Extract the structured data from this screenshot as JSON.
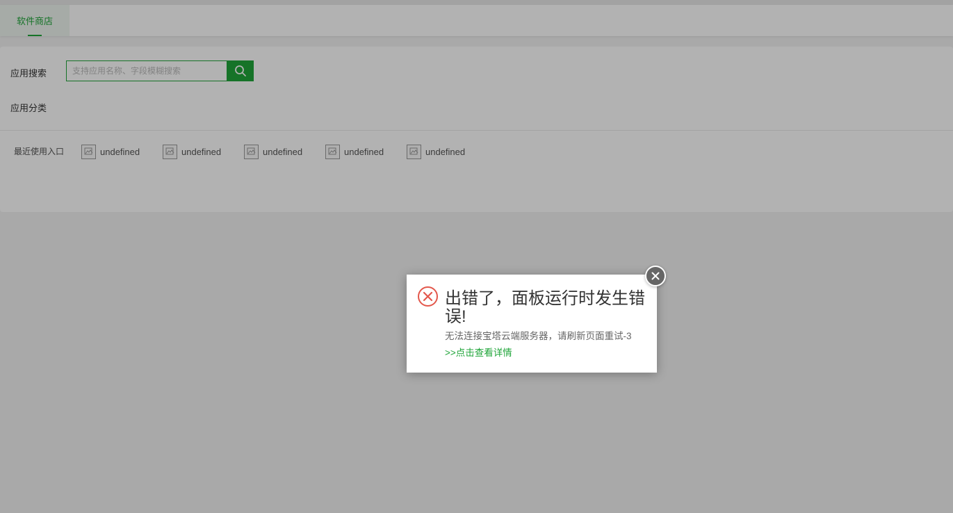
{
  "tabs": [
    {
      "label": "软件商店"
    }
  ],
  "search": {
    "label": "应用搜索",
    "placeholder": "支持应用名称、字段模糊搜索"
  },
  "category": {
    "label": "应用分类"
  },
  "recent": {
    "label": "最近使用入口",
    "items": [
      {
        "label": "undefined"
      },
      {
        "label": "undefined"
      },
      {
        "label": "undefined"
      },
      {
        "label": "undefined"
      },
      {
        "label": "undefined"
      }
    ]
  },
  "dialog": {
    "title": "出错了，面板运行时发生错误!",
    "message": "无法连接宝塔云端服务器，请刷新页面重试-3",
    "link": ">>点击查看详情"
  },
  "colors": {
    "accent": "#20a53a",
    "error": "#e3574b"
  },
  "icons": {
    "search": "search-icon",
    "error": "error-circle-icon",
    "close": "close-icon",
    "broken_image": "broken-image-icon"
  }
}
